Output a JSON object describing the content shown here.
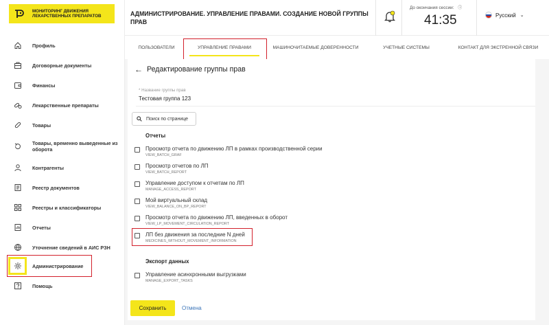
{
  "app": {
    "logo_text": "МОНИТОРИНГ ДВИЖЕНИЯ ЛЕКАРСТВЕННЫХ ПРЕПАРАТОВ",
    "accent_color": "#f4e51a",
    "highlight_color": "#d21f2a"
  },
  "sidebar": {
    "items": [
      {
        "label": "Профиль",
        "icon": "home-icon"
      },
      {
        "label": "Договорные документы",
        "icon": "briefcase-icon"
      },
      {
        "label": "Финансы",
        "icon": "wallet-icon"
      },
      {
        "label": "Лекарственные препараты",
        "icon": "pills-icon"
      },
      {
        "label": "Товары",
        "icon": "pill-icon"
      },
      {
        "label": "Товары, временно выведенные из оборота",
        "icon": "return-icon"
      },
      {
        "label": "Контрагенты",
        "icon": "user-icon"
      },
      {
        "label": "Реестр документов",
        "icon": "document-list-icon"
      },
      {
        "label": "Реестры и классификаторы",
        "icon": "grid-icon"
      },
      {
        "label": "Отчеты",
        "icon": "report-icon"
      },
      {
        "label": "Уточнение сведений в АИС РЗН",
        "icon": "globe-icon"
      },
      {
        "label": "Администрирование",
        "icon": "gear-icon",
        "active": true
      },
      {
        "label": "Помощь",
        "icon": "help-icon"
      }
    ]
  },
  "header": {
    "title": "АДМИНИСТРИРОВАНИЕ. УПРАВЛЕНИЕ ПРАВАМИ. СОЗДАНИЕ НОВОЙ ГРУППЫ ПРАВ",
    "session_label": "До окончания сессии:",
    "session_time": "41:35",
    "language": "Русский"
  },
  "tabs": [
    {
      "label": "ПОЛЬЗОВАТЕЛИ"
    },
    {
      "label": "УПРАВЛЕНИЕ ПРАВАМИ",
      "active": true
    },
    {
      "label": "МАШИНОЧИТАЕМЫЕ ДОВЕРЕННОСТИ"
    },
    {
      "label": "УЧЕТНЫЕ СИСТЕМЫ"
    },
    {
      "label": "КОНТАКТ ДЛЯ ЭКСТРЕННОЙ СВЯЗИ"
    }
  ],
  "form": {
    "title": "Редактирование группы прав",
    "group_name_label": "* Название группы прав",
    "group_name_value": "Тестовая группа 123",
    "search_placeholder": "Поиск по странице",
    "sections": [
      {
        "heading": "Отчеты",
        "permissions": [
          {
            "title": "Просмотр отчета по движению ЛП в рамках производственной серии",
            "code": "VIEW_BATCH_GRAF",
            "checked": false
          },
          {
            "title": "Просмотр отчетов по ЛП",
            "code": "VIEW_BATCH_REPORT",
            "checked": false
          },
          {
            "title": "Управление доступом к отчетам по ЛП",
            "code": "MANAGE_ACCESS_REPORT",
            "checked": false
          },
          {
            "title": "Мой виртуальный склад",
            "code": "VIEW_BALANCE_ON_BP_REPORT",
            "checked": false
          },
          {
            "title": "Просмотр отчета по движению ЛП, введенных в оборот",
            "code": "VIEW_LP_MOVEMENT_CIRCULATION_REPORT",
            "checked": false
          },
          {
            "title": "ЛП без движения за последние N дней",
            "code": "MEDICINES_WITHOUT_MOVEMENT_INFORMATION",
            "checked": false
          }
        ]
      },
      {
        "heading": "Экспорт данных",
        "permissions": [
          {
            "title": "Управление асинхронными выгрузками",
            "code": "MANAGE_EXPORT_TASKS",
            "checked": false
          }
        ]
      }
    ],
    "save_label": "Сохранить",
    "cancel_label": "Отмена"
  }
}
